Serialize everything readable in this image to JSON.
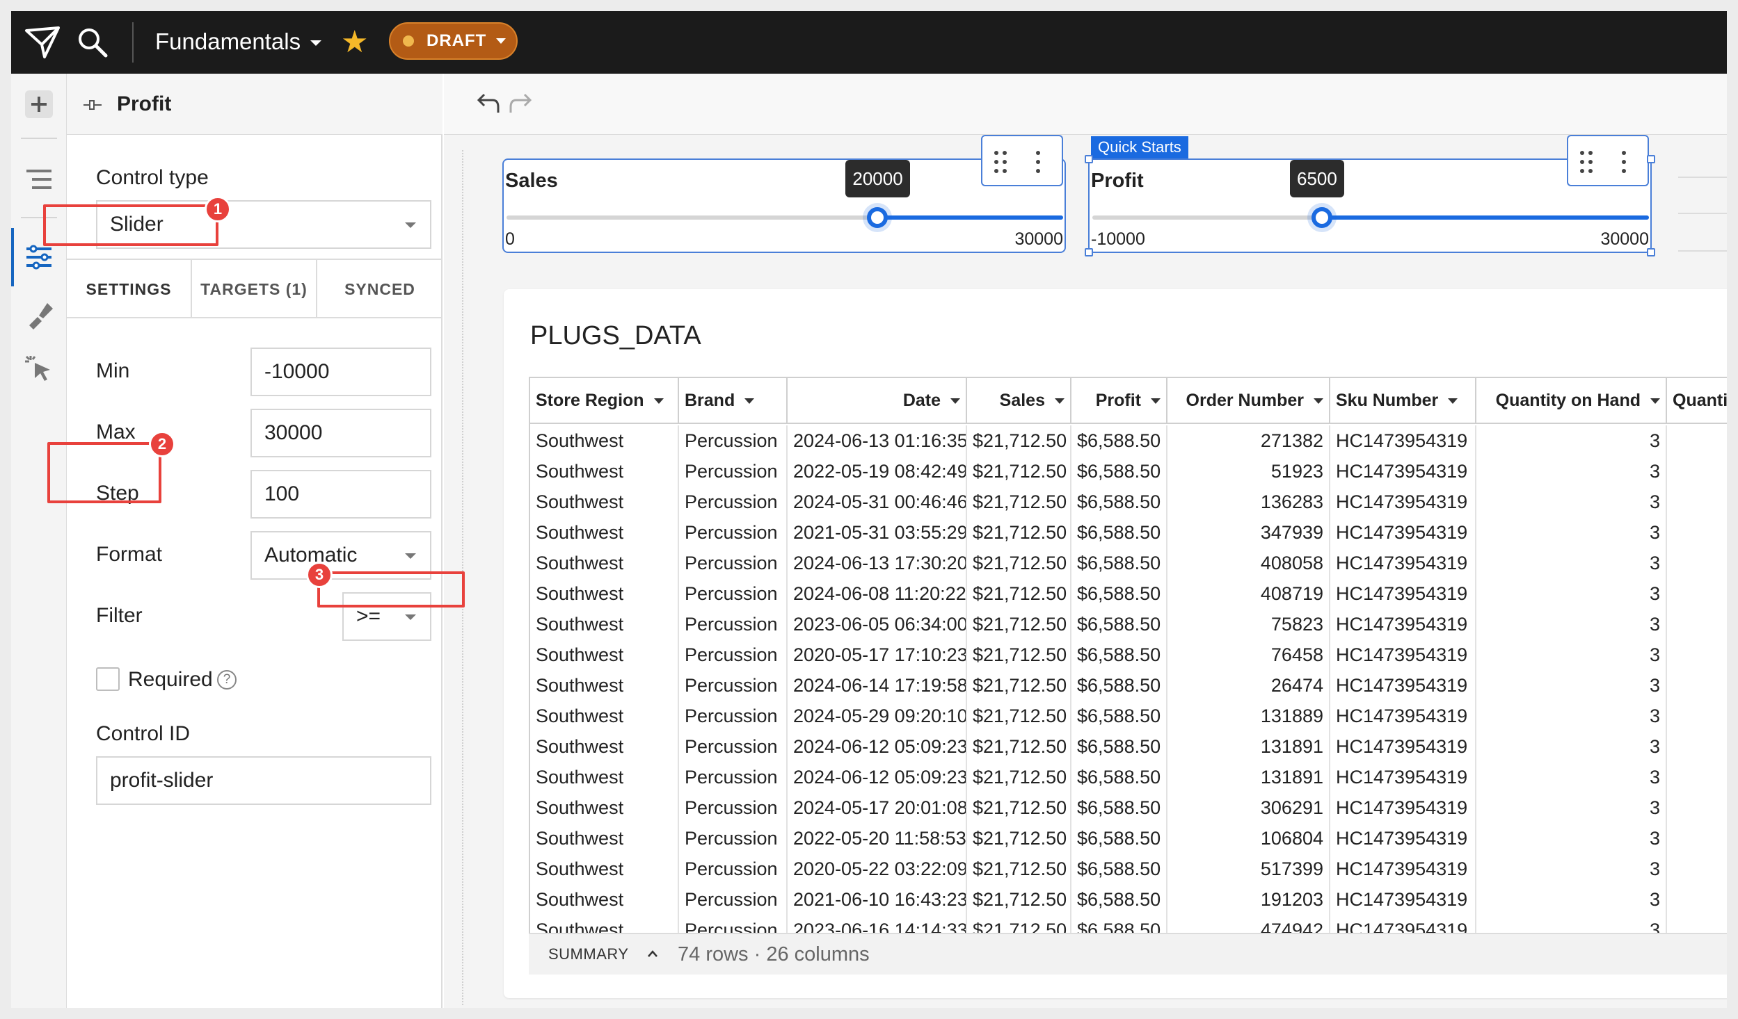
{
  "topbar": {
    "doc_title": "Fundamentals",
    "status": "DRAFT"
  },
  "panel": {
    "title": "Profit",
    "control_type_label": "Control type",
    "control_type_value": "Slider",
    "tabs": [
      "SETTINGS",
      "TARGETS (1)",
      "SYNCED"
    ],
    "min_label": "Min",
    "min_value": "-10000",
    "max_label": "Max",
    "max_value": "30000",
    "step_label": "Step",
    "step_value": "100",
    "format_label": "Format",
    "format_value": "Automatic",
    "filter_label": "Filter",
    "filter_value": ">=",
    "required_label": "Required",
    "required_checked": false,
    "control_id_label": "Control ID",
    "control_id_value": "profit-slider",
    "help_glyph": "?"
  },
  "callouts": [
    "1",
    "2",
    "3"
  ],
  "sales_slider": {
    "title": "Sales",
    "value": "20000",
    "min": "0",
    "max": "30000",
    "fraction": 0.6667
  },
  "profit_slider": {
    "title": "Profit",
    "badge": "Quick Starts",
    "value": "6500",
    "min": "-10000",
    "max": "30000",
    "fraction": 0.4125
  },
  "table": {
    "title": "PLUGS_DATA",
    "columns": [
      "Store Region",
      "Brand",
      "Date",
      "Sales",
      "Profit",
      "Order Number",
      "Sku Number",
      "Quantity on Hand",
      "Quantity"
    ],
    "rows": [
      [
        "Southwest",
        "Percussion",
        "2024-06-13 01:16:35",
        "$21,712.50",
        "$6,588.50",
        "271382",
        "HC1473954319",
        "3"
      ],
      [
        "Southwest",
        "Percussion",
        "2022-05-19 08:42:49",
        "$21,712.50",
        "$6,588.50",
        "51923",
        "HC1473954319",
        "3"
      ],
      [
        "Southwest",
        "Percussion",
        "2024-05-31 00:46:46",
        "$21,712.50",
        "$6,588.50",
        "136283",
        "HC1473954319",
        "3"
      ],
      [
        "Southwest",
        "Percussion",
        "2021-05-31 03:55:29",
        "$21,712.50",
        "$6,588.50",
        "347939",
        "HC1473954319",
        "3"
      ],
      [
        "Southwest",
        "Percussion",
        "2024-06-13 17:30:20",
        "$21,712.50",
        "$6,588.50",
        "408058",
        "HC1473954319",
        "3"
      ],
      [
        "Southwest",
        "Percussion",
        "2024-06-08 11:20:22",
        "$21,712.50",
        "$6,588.50",
        "408719",
        "HC1473954319",
        "3"
      ],
      [
        "Southwest",
        "Percussion",
        "2023-06-05 06:34:00",
        "$21,712.50",
        "$6,588.50",
        "75823",
        "HC1473954319",
        "3"
      ],
      [
        "Southwest",
        "Percussion",
        "2020-05-17 17:10:23",
        "$21,712.50",
        "$6,588.50",
        "76458",
        "HC1473954319",
        "3"
      ],
      [
        "Southwest",
        "Percussion",
        "2024-06-14 17:19:58",
        "$21,712.50",
        "$6,588.50",
        "26474",
        "HC1473954319",
        "3"
      ],
      [
        "Southwest",
        "Percussion",
        "2024-05-29 09:20:10",
        "$21,712.50",
        "$6,588.50",
        "131889",
        "HC1473954319",
        "3"
      ],
      [
        "Southwest",
        "Percussion",
        "2024-06-12 05:09:23",
        "$21,712.50",
        "$6,588.50",
        "131891",
        "HC1473954319",
        "3"
      ],
      [
        "Southwest",
        "Percussion",
        "2024-06-12 05:09:23",
        "$21,712.50",
        "$6,588.50",
        "131891",
        "HC1473954319",
        "3"
      ],
      [
        "Southwest",
        "Percussion",
        "2024-05-17 20:01:08",
        "$21,712.50",
        "$6,588.50",
        "306291",
        "HC1473954319",
        "3"
      ],
      [
        "Southwest",
        "Percussion",
        "2022-05-20 11:58:53",
        "$21,712.50",
        "$6,588.50",
        "106804",
        "HC1473954319",
        "3"
      ],
      [
        "Southwest",
        "Percussion",
        "2020-05-22 03:22:09",
        "$21,712.50",
        "$6,588.50",
        "517399",
        "HC1473954319",
        "3"
      ],
      [
        "Southwest",
        "Percussion",
        "2021-06-10 16:43:23",
        "$21,712.50",
        "$6,588.50",
        "191203",
        "HC1473954319",
        "3"
      ],
      [
        "Southwest",
        "Percussion",
        "2023-06-16 14:14:33",
        "$21,712.50",
        "$6,588.50",
        "474942",
        "HC1473954319",
        "3"
      ]
    ],
    "summary_label": "SUMMARY",
    "summary_text": "74 rows · 26 columns"
  },
  "colors": {
    "accent": "#1a6ae0",
    "callout": "#e8413c",
    "draft": "#b35b15",
    "star": "#f5b829"
  },
  "icons": [
    "logo-icon",
    "search-icon",
    "star-icon",
    "add-icon",
    "outline-icon",
    "controls-icon",
    "paint-icon",
    "interaction-icon",
    "undo-icon",
    "redo-icon",
    "drag-handle-icon",
    "more-icon",
    "chevron-up-icon"
  ]
}
